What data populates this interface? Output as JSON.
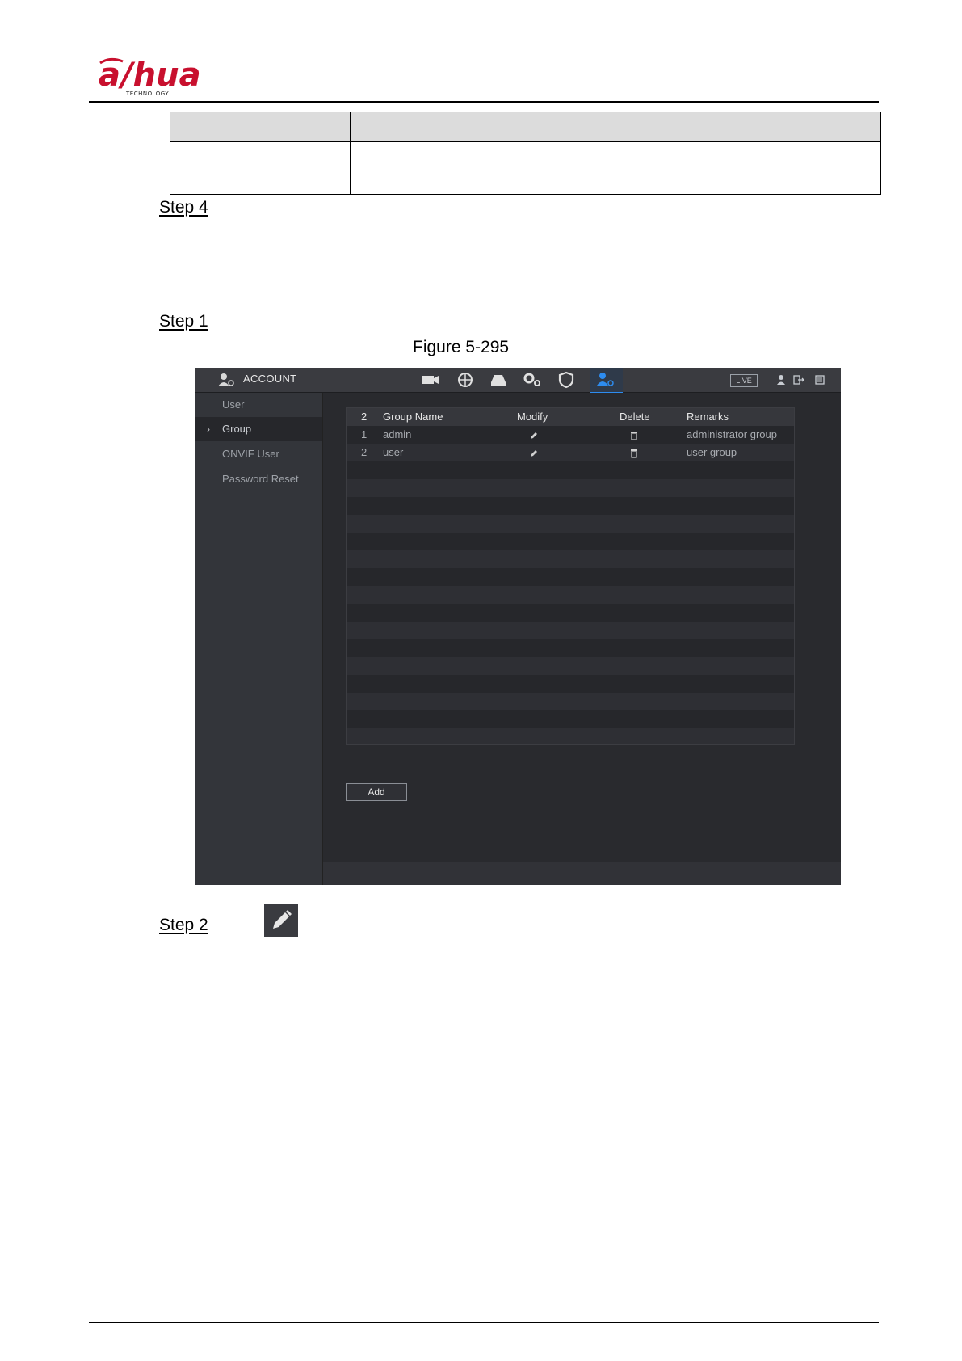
{
  "header": {
    "logo_text": "alhua",
    "logo_subtext": "TECHNOLOGY"
  },
  "steps": {
    "step4": "Step 4",
    "step1": "Step 1",
    "step2": "Step 2"
  },
  "caption": "Figure 5-295",
  "screenshot": {
    "title": "ACCOUNT",
    "live_label": "LIVE",
    "sidebar": {
      "items": [
        {
          "label": "User"
        },
        {
          "label": "Group",
          "active": true
        },
        {
          "label": "ONVIF User"
        },
        {
          "label": "Password Reset"
        }
      ],
      "active_arrow": "›"
    },
    "table": {
      "columns": [
        "2",
        "Group Name",
        "Modify",
        "Delete",
        "Remarks"
      ],
      "rows": [
        {
          "index": "1",
          "group_name": "admin",
          "remarks": "administrator group"
        },
        {
          "index": "2",
          "group_name": "user",
          "remarks": "user group"
        }
      ]
    },
    "add_label": "Add",
    "colors": {
      "accent": "#2d8cf0",
      "background": "#2b2c30",
      "topbar": "#3a3b40"
    },
    "icons": [
      "account-icon",
      "camera-icon",
      "network-icon",
      "storage-icon",
      "system-icon",
      "security-icon",
      "account-active-icon",
      "user-icon",
      "logout-icon",
      "menu-icon",
      "pencil-icon",
      "trash-icon"
    ]
  }
}
